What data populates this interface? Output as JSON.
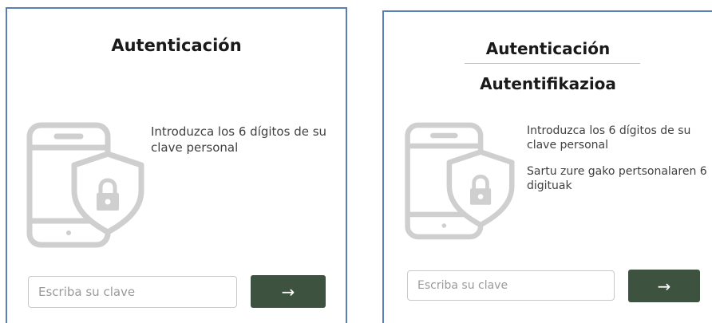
{
  "colors": {
    "panel_border": "#5b7fb5",
    "button_bg": "#3e5240",
    "icon_gray": "#cfcfcf"
  },
  "left_panel": {
    "title": "Autenticación",
    "message": "Introduzca los 6 dígitos de su clave personal",
    "input_placeholder": "Escriba su clave",
    "submit_label": "→",
    "icon": "phone-shield-lock-icon"
  },
  "right_panel": {
    "title_es": "Autenticación",
    "title_eu": "Autentifikazioa",
    "message_es": "Introduzca los 6 dígitos de su clave personal",
    "message_eu": "Sartu zure gako pertsonalaren 6 digituak",
    "input_placeholder": "Escriba su clave",
    "submit_label": "→",
    "icon": "phone-shield-lock-icon"
  }
}
